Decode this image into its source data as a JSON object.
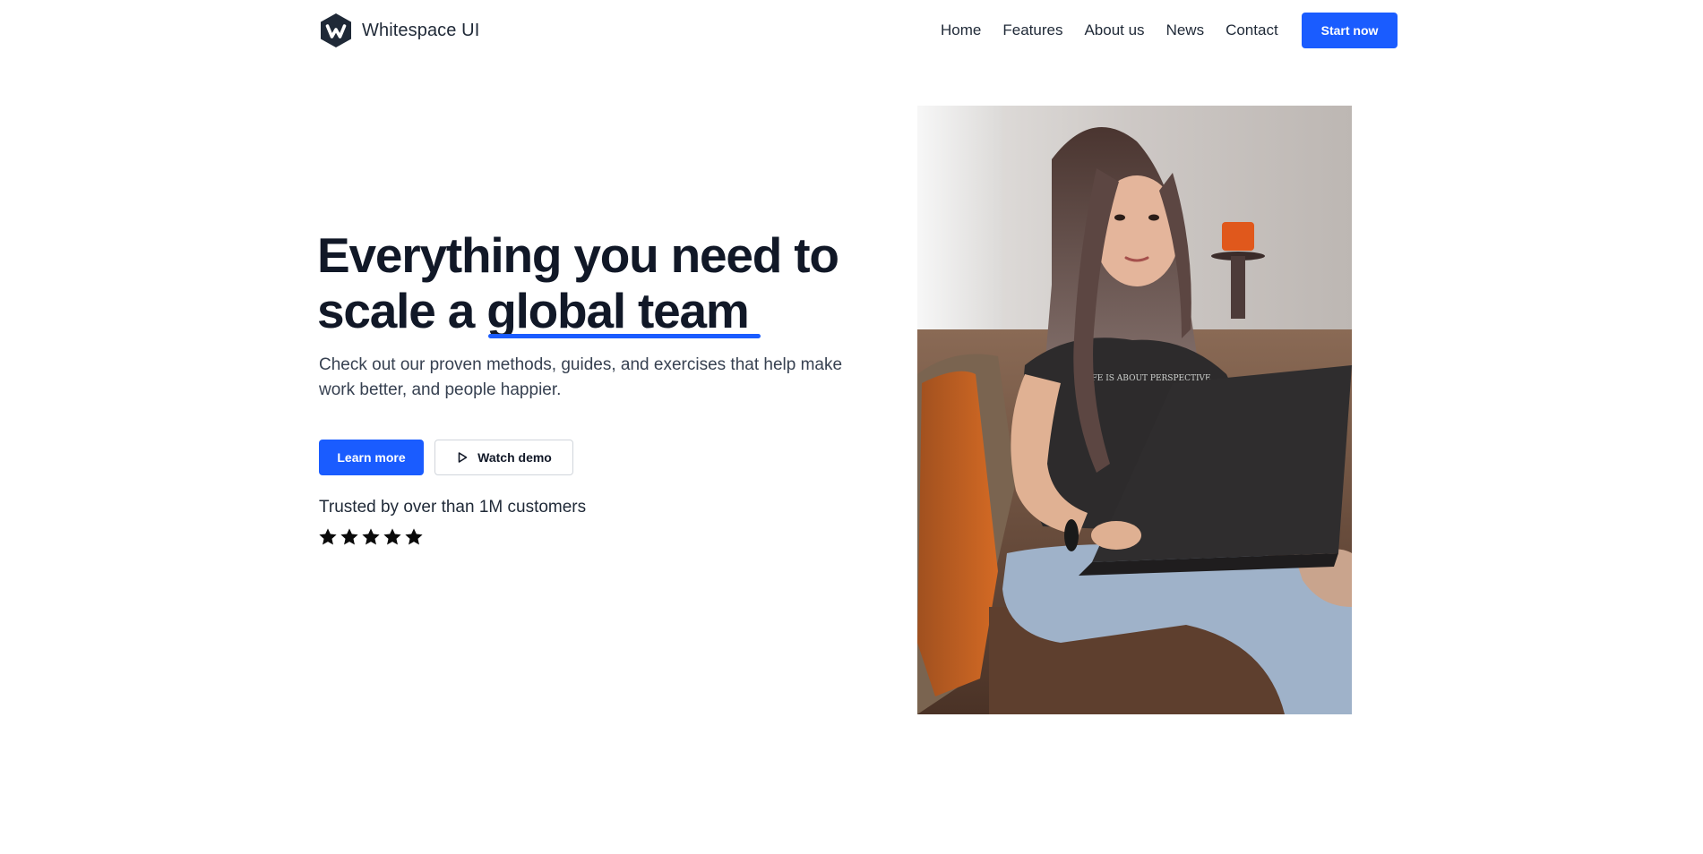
{
  "brand": {
    "name": "Whitespace UI",
    "logo_icon": "hexagon-w-logo-icon"
  },
  "nav": {
    "items": [
      {
        "label": "Home"
      },
      {
        "label": "Features"
      },
      {
        "label": "About us"
      },
      {
        "label": "News"
      },
      {
        "label": "Contact"
      }
    ],
    "cta_label": "Start now"
  },
  "hero": {
    "title_line1": "Everything you need to",
    "title_line2_prefix": "scale a ",
    "title_highlight": "global team",
    "subtitle": "Check out our proven methods, guides, and exercises that help make work better, and people happier.",
    "primary_button": "Learn more",
    "secondary_button": "Watch demo",
    "secondary_button_icon": "play-icon",
    "trusted_text": "Trusted by over than 1M customers",
    "rating_stars": 5,
    "star_icon": "star-icon"
  },
  "photo": {
    "subject": "woman-with-laptop-photo",
    "shirt_text": "LIFE IS ABOUT PERSPECTIVE"
  },
  "colors": {
    "accent": "#1a5cff",
    "text": "#111827",
    "muted_text": "#374151",
    "logo_dark": "#1f2937",
    "background": "#ffffff"
  }
}
